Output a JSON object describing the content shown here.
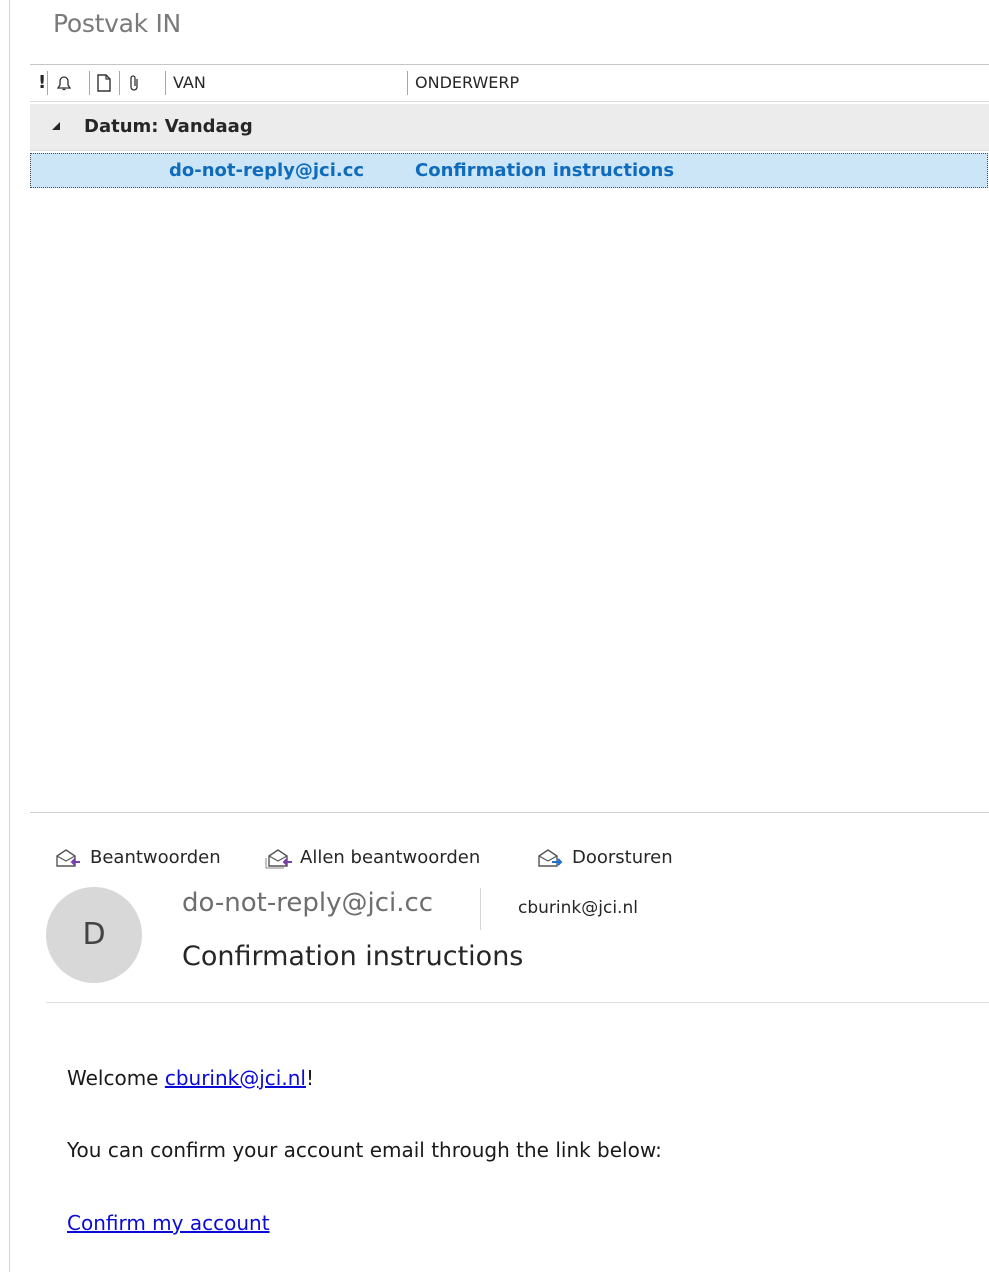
{
  "folder_title": "Postvak IN",
  "columns": {
    "importance": "!",
    "from": "VAN",
    "subject": "ONDERWERP"
  },
  "group": {
    "label": "Datum: Vandaag"
  },
  "message_row": {
    "from": "do-not-reply@jci.cc",
    "subject": "Confirmation instructions"
  },
  "actions": {
    "reply": "Beantwoorden",
    "reply_all": "Allen beantwoorden",
    "forward": "Doorsturen"
  },
  "reading_pane": {
    "avatar_initial": "D",
    "sender": "do-not-reply@jci.cc",
    "to": "cburink@jci.nl",
    "subject": "Confirmation instructions",
    "body": {
      "welcome_prefix": "Welcome ",
      "welcome_link": "cburink@jci.nl",
      "welcome_suffix": "!",
      "line2": "You can confirm your account email through the link below:",
      "confirm_link": "Confirm my account"
    }
  },
  "colors": {
    "selected_row_bg": "#cde6f7",
    "unread_blue": "#0f6cbd",
    "link_blue": "#0b0bd6",
    "group_bg": "#ececec"
  },
  "icons": [
    "bell-icon",
    "document-icon",
    "paperclip-icon",
    "triangle-collapse-icon",
    "reply-icon",
    "reply-all-icon",
    "forward-icon"
  ]
}
